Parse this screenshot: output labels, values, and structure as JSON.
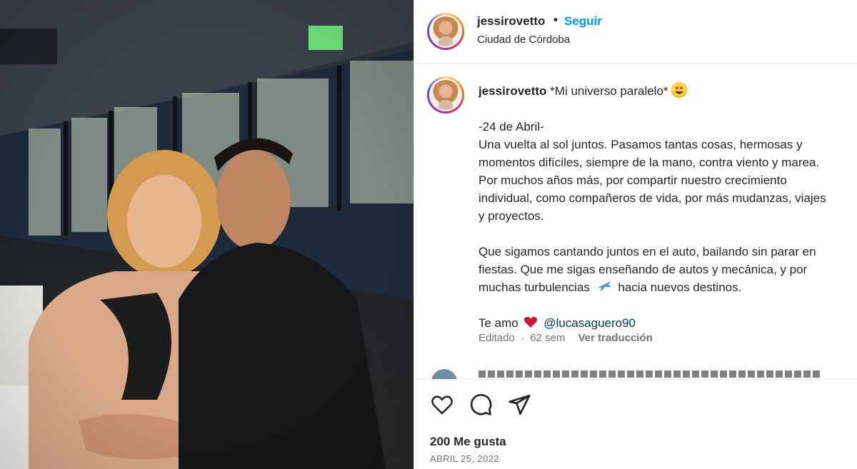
{
  "post": {
    "username": "jessirovetto",
    "dot": "•",
    "follow_label": "Seguir",
    "location": "Ciudad de Córdoba"
  },
  "caption": {
    "username": "jessirovetto",
    "first_line": "*Mi universo paralelo*",
    "lines": [
      "-24 de Abril-",
      "Una vuelta al sol juntos. Pasamos tantas cosas, hermosas y",
      "momentos difíciles, siempre de la mano, contra viento y marea.",
      "Por muchos años más, por compartir nuestro crecimiento",
      "individual, como compañeros de vida, por más mudanzas, viajes",
      "y proyectos."
    ],
    "lines2": [
      "Que sigamos cantando juntos en el auto, bailando sin parar en",
      "fiestas. Que me sigas enseñando de autos y mecánica, y por"
    ],
    "line_plane_before": "muchas turbulencias",
    "line_plane_after": "hacia nuevos destinos.",
    "love_prefix": "Te amo",
    "mention": "@lucasaguero90",
    "edited": "Editado",
    "age": "62 sem",
    "translate": "Ver traducción"
  },
  "actions": {
    "like_icon": "heart-icon",
    "comment_icon": "comment-icon",
    "share_icon": "send-icon"
  },
  "likes": "200 Me gusta",
  "date": "ABRIL 25, 2022",
  "colors": {
    "follow": "#0095f6",
    "mention": "#00376b",
    "muted": "#737373"
  }
}
